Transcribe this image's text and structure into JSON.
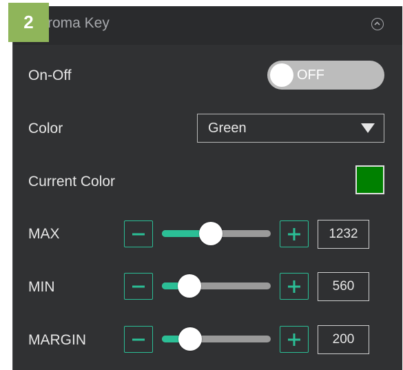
{
  "step_badge": "2",
  "panel": {
    "title": "roma Key",
    "collapse_icon": "chevron-up-circle-icon"
  },
  "onoff": {
    "label": "On-Off",
    "state_text": "OFF",
    "enabled": false
  },
  "color": {
    "label": "Color",
    "selected": "Green",
    "dropdown_icon": "triangle-down-icon"
  },
  "current_color": {
    "label": "Current Color",
    "swatch": "#008000"
  },
  "accent": "#2bbf96",
  "sliders": [
    {
      "label": "MAX",
      "value": "1232",
      "position": 0.45,
      "minus_icon": "minus-icon",
      "plus_icon": "plus-icon"
    },
    {
      "label": "MIN",
      "value": "560",
      "position": 0.25,
      "minus_icon": "minus-icon",
      "plus_icon": "plus-icon"
    },
    {
      "label": "MARGIN",
      "value": "200",
      "position": 0.26,
      "minus_icon": "minus-icon",
      "plus_icon": "plus-icon"
    }
  ]
}
